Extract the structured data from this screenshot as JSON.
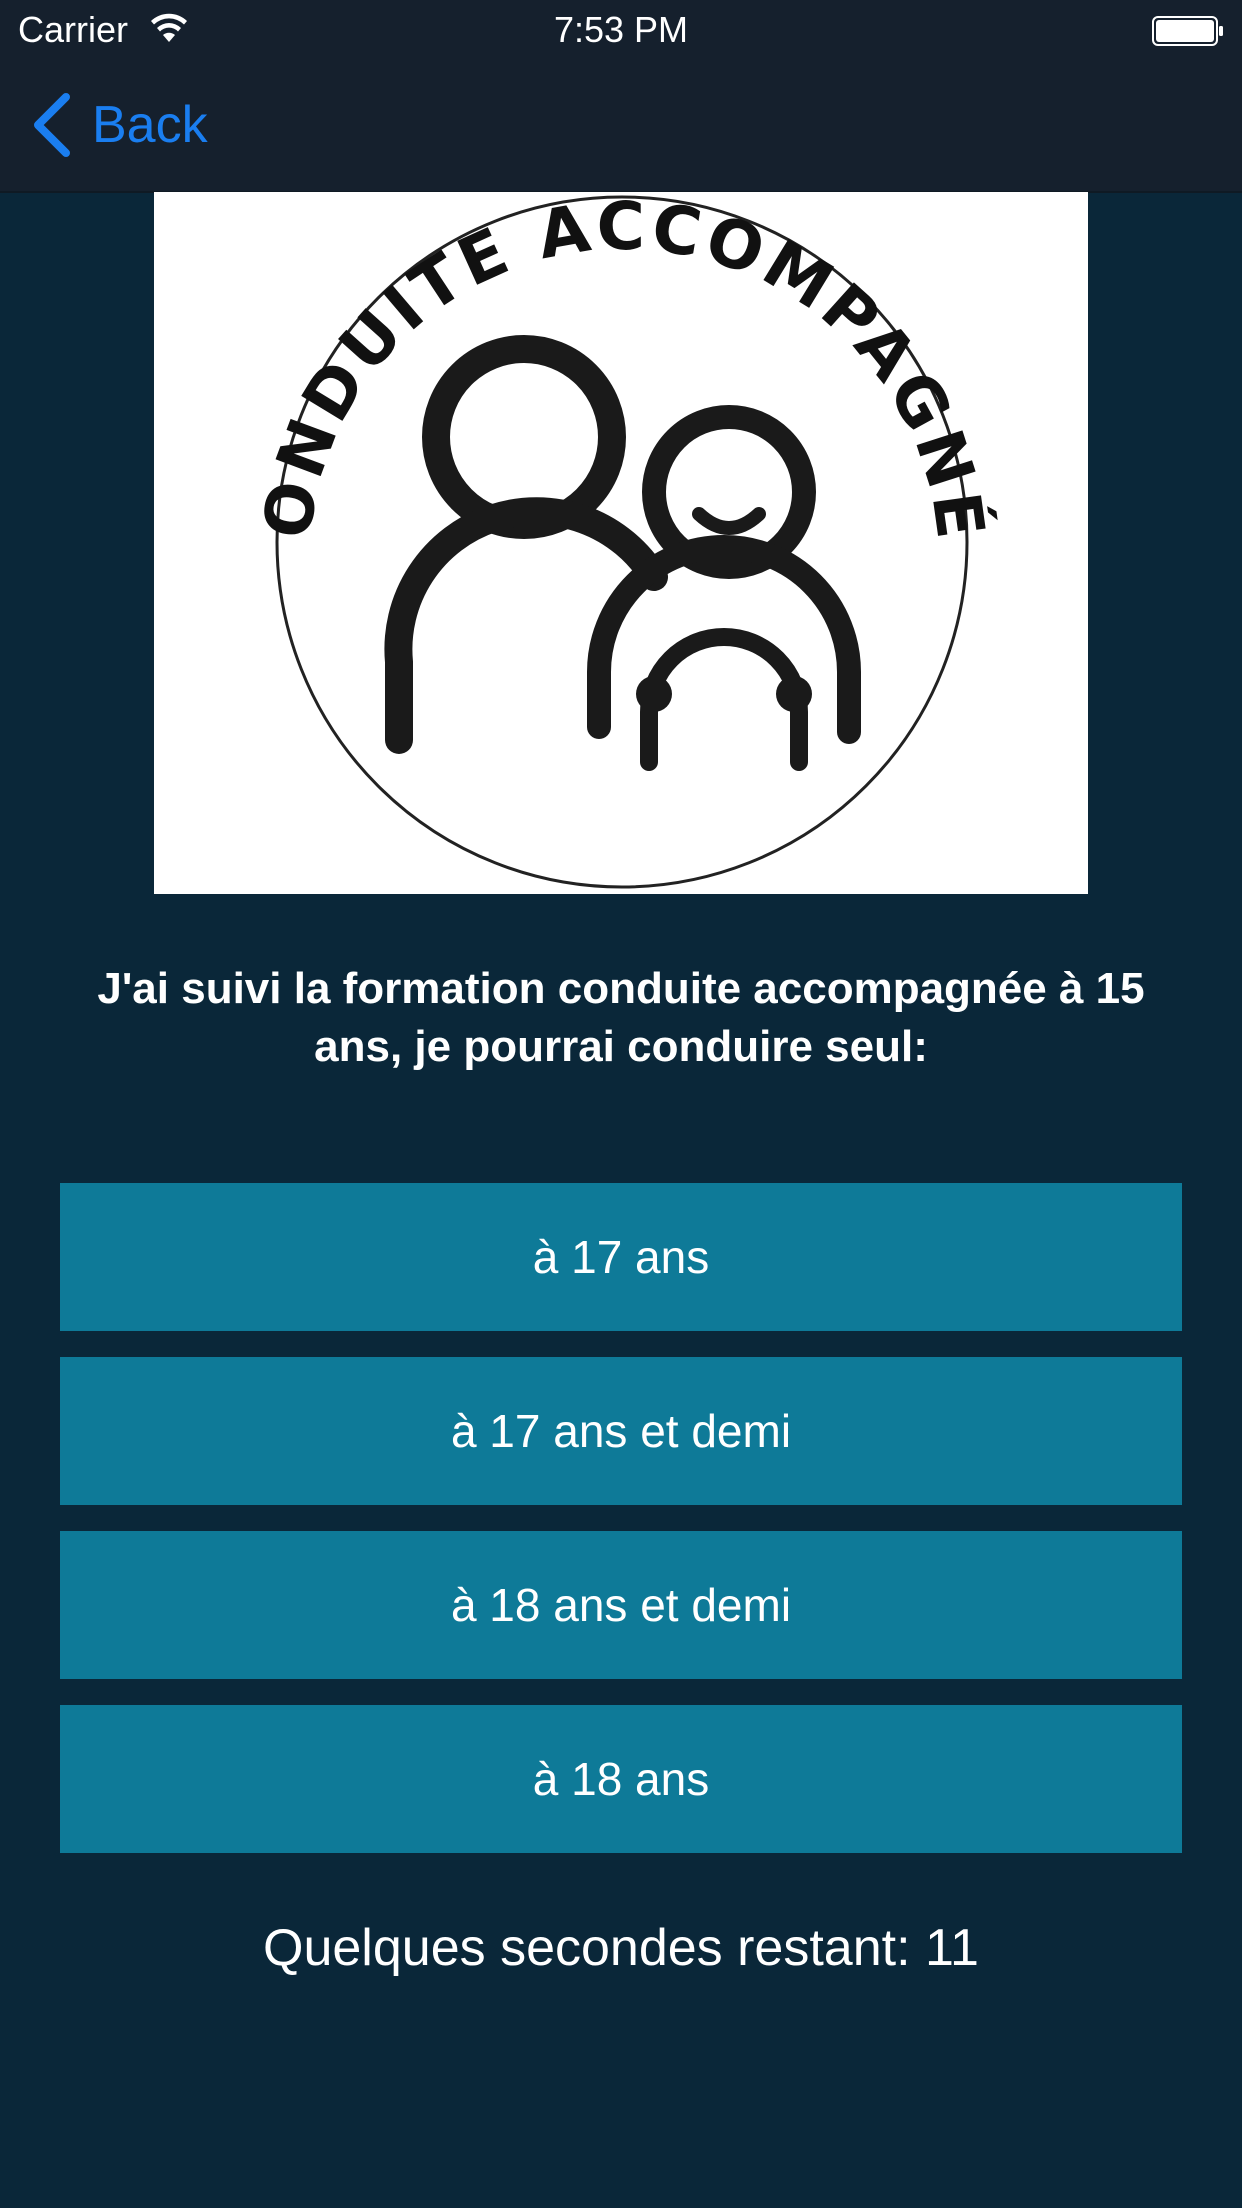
{
  "status_bar": {
    "carrier": "Carrier",
    "time": "7:53 PM"
  },
  "nav": {
    "back_label": "Back"
  },
  "image": {
    "logo_text": "CONDUITE ACCOMPAGNÉE"
  },
  "question": "J'ai suivi la formation conduite accompagnée à 15 ans, je pourrai conduire seul:",
  "answers": [
    {
      "label": "à 17 ans"
    },
    {
      "label": "à 17 ans et demi"
    },
    {
      "label": "à 18 ans et demi"
    },
    {
      "label": "à 18 ans"
    }
  ],
  "timer_text": "Quelques secondes restant: 11",
  "colors": {
    "background": "#0a2739",
    "navbar": "#15202d",
    "accent": "#1a7ef0",
    "answer_button": "#0e7a98"
  }
}
